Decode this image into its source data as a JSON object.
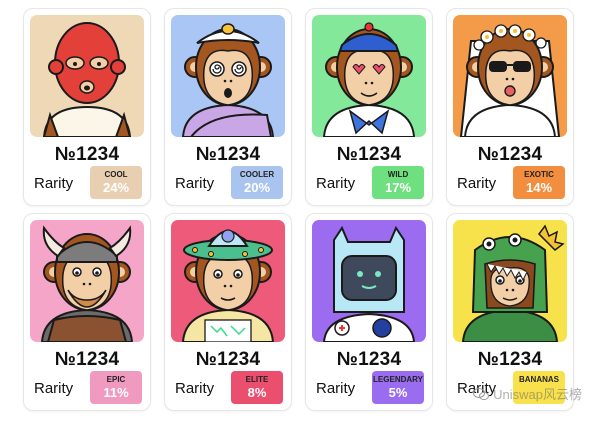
{
  "cards": [
    {
      "number": "№1234",
      "rarity_label": "Rarity",
      "tier": "COOL",
      "percent": "24%",
      "bg": "#efd8b6",
      "badge_bg": "#e9cfb1",
      "character": "red-mask-monkey"
    },
    {
      "number": "№1234",
      "rarity_label": "Rarity",
      "tier": "COOLER",
      "percent": "20%",
      "bg": "#a9c6f4",
      "badge_bg": "#a9c4ee",
      "character": "egg-hat-monkey"
    },
    {
      "number": "№1234",
      "rarity_label": "Rarity",
      "tier": "WILD",
      "percent": "17%",
      "bg": "#84e89a",
      "badge_bg": "#6ee07f",
      "character": "sailor-monkey"
    },
    {
      "number": "№1234",
      "rarity_label": "Rarity",
      "tier": "EXOTIC",
      "percent": "14%",
      "bg": "#f49b4a",
      "badge_bg": "#f48e3f",
      "character": "bride-monkey"
    },
    {
      "number": "№1234",
      "rarity_label": "Rarity",
      "tier": "EPIC",
      "percent": "11%",
      "bg": "#f5a6c8",
      "badge_bg": "#f19ac0",
      "character": "viking-monkey"
    },
    {
      "number": "№1234",
      "rarity_label": "Rarity",
      "tier": "ELITE",
      "percent": "8%",
      "bg": "#ee5a79",
      "badge_bg": "#eb4f6e",
      "character": "ufo-monkey"
    },
    {
      "number": "№1234",
      "rarity_label": "Rarity",
      "tier": "LEGENDARY",
      "percent": "5%",
      "bg": "#9b6cf0",
      "badge_bg": "#9a6cf0",
      "character": "astronaut-monkey"
    },
    {
      "number": "№1234",
      "rarity_label": "Rarity",
      "tier": "BANANAS",
      "percent": "",
      "bg": "#f8e24c",
      "badge_bg": "#f8e14a",
      "character": "dino-monkey"
    }
  ],
  "watermark": "Uniswap风云榜"
}
